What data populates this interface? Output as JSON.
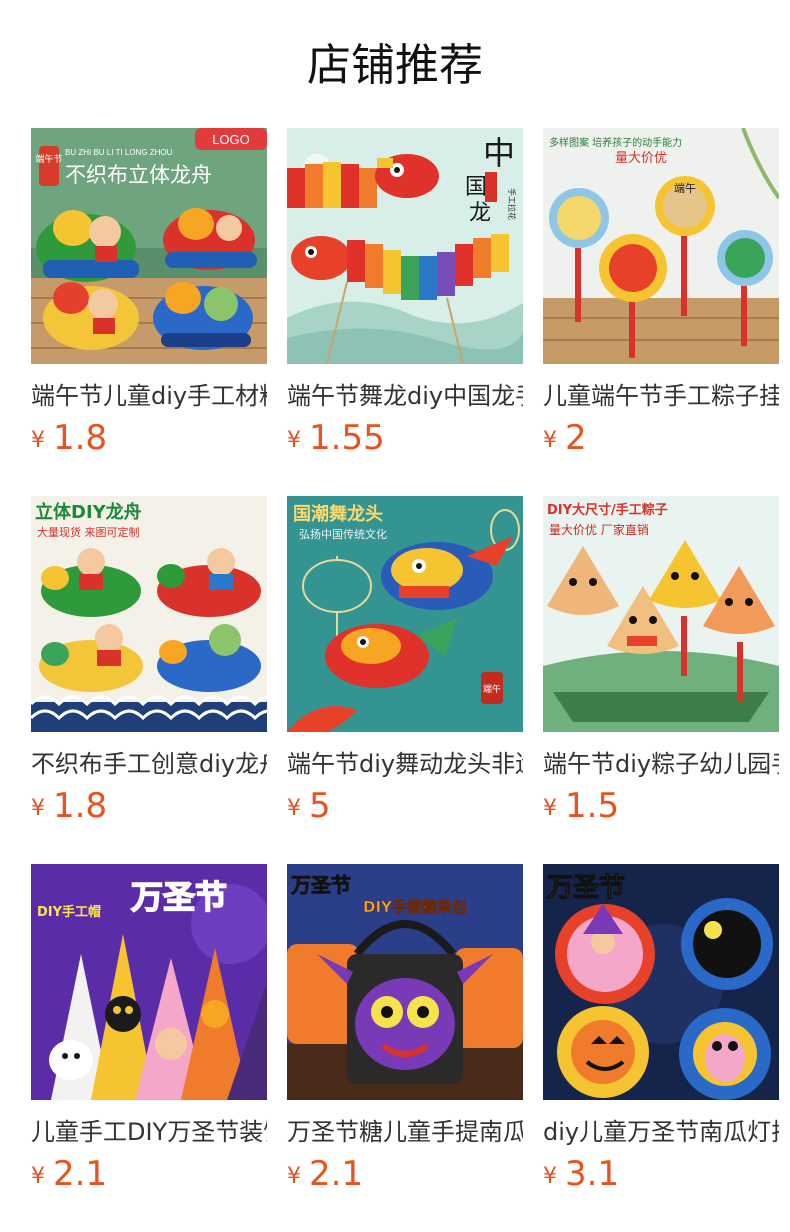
{
  "page": {
    "title": "店铺推荐"
  },
  "colors": {
    "price": "#e8521d",
    "title": "#111111",
    "product_name": "#333333"
  },
  "products": [
    {
      "name": "端午节儿童diy手工材料包",
      "currency": "¥",
      "price": "1.8",
      "image": {
        "theme": "dragon-boat-felt",
        "banner_text": "不织布立体龙舟",
        "badge": "LOGO",
        "tag": "端午节",
        "pinyin": "BU ZHI BU LI TI LONG ZHOU"
      }
    },
    {
      "name": "端午节舞龙diy中国龙手工拉花",
      "currency": "¥",
      "price": "1.55",
      "image": {
        "theme": "chinese-dragon-garland",
        "title_chars": [
          "中",
          "国",
          "龙"
        ],
        "subtitle": "手工拉花",
        "seal": "儿童手工"
      }
    },
    {
      "name": "儿童端午节手工粽子挂饰",
      "currency": "¥",
      "price": "2",
      "image": {
        "theme": "zongzi-ornaments",
        "headline": "多样图案 培养孩子的动手能力",
        "subline": "量大价优",
        "ornament_text": "端午"
      }
    },
    {
      "name": "不织布手工创意diy龙舟",
      "currency": "¥",
      "price": "1.8",
      "image": {
        "theme": "3d-dragon-boat",
        "headline": "立体DIY龙舟",
        "subline": "大量现货 来图可定制"
      }
    },
    {
      "name": "端午节diy舞动龙头非遗手工",
      "currency": "¥",
      "price": "5",
      "image": {
        "theme": "guochao-dragon-head",
        "headline": "国潮舞龙头",
        "subline": "弘扬中国传统文化",
        "seal": "端午"
      }
    },
    {
      "name": "端午节diy粽子幼儿园手工",
      "currency": "¥",
      "price": "1.5",
      "image": {
        "theme": "big-zongzi",
        "headline": "DIY大尺寸/手工粽子",
        "subline": "量大价优 厂家直销"
      }
    },
    {
      "name": "儿童手工DIY万圣节装饰帽",
      "currency": "¥",
      "price": "2.1",
      "image": {
        "theme": "halloween-hats",
        "headline": "万圣节",
        "label": "DIY手工帽"
      }
    },
    {
      "name": "万圣节糖儿童手提南瓜袋",
      "currency": "¥",
      "price": "2.1",
      "image": {
        "theme": "halloween-candy-bag",
        "headline": "万圣节",
        "label": "DIY手提糖果包"
      }
    },
    {
      "name": "diy儿童万圣节南瓜灯挂饰",
      "currency": "¥",
      "price": "3.1",
      "image": {
        "theme": "halloween-wreaths",
        "headline": "万圣节"
      }
    }
  ]
}
